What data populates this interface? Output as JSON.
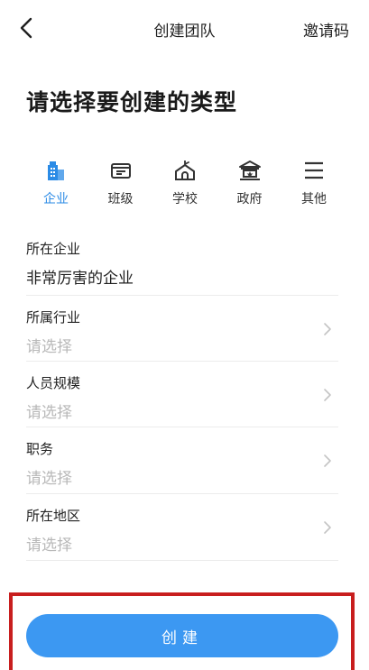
{
  "nav": {
    "title": "创建团队",
    "invite_label": "邀请码"
  },
  "heading": "请选择要创建的类型",
  "types": [
    {
      "label": "企业",
      "icon": "building-icon",
      "active": true
    },
    {
      "label": "班级",
      "icon": "class-icon",
      "active": false
    },
    {
      "label": "学校",
      "icon": "school-icon",
      "active": false
    },
    {
      "label": "政府",
      "icon": "government-icon",
      "active": false
    },
    {
      "label": "其他",
      "icon": "menu-icon",
      "active": false
    }
  ],
  "form": {
    "company": {
      "label": "所在企业",
      "value": "非常厉害的企业"
    },
    "industry": {
      "label": "所属行业",
      "placeholder": "请选择"
    },
    "size": {
      "label": "人员规模",
      "placeholder": "请选择"
    },
    "position": {
      "label": "职务",
      "placeholder": "请选择"
    },
    "region": {
      "label": "所在地区",
      "placeholder": "请选择"
    }
  },
  "create_label": "创建",
  "colors": {
    "accent": "#2b8be6",
    "button": "#3c98f2",
    "highlight_border": "#c81e1e",
    "placeholder": "#b8b8b8"
  }
}
